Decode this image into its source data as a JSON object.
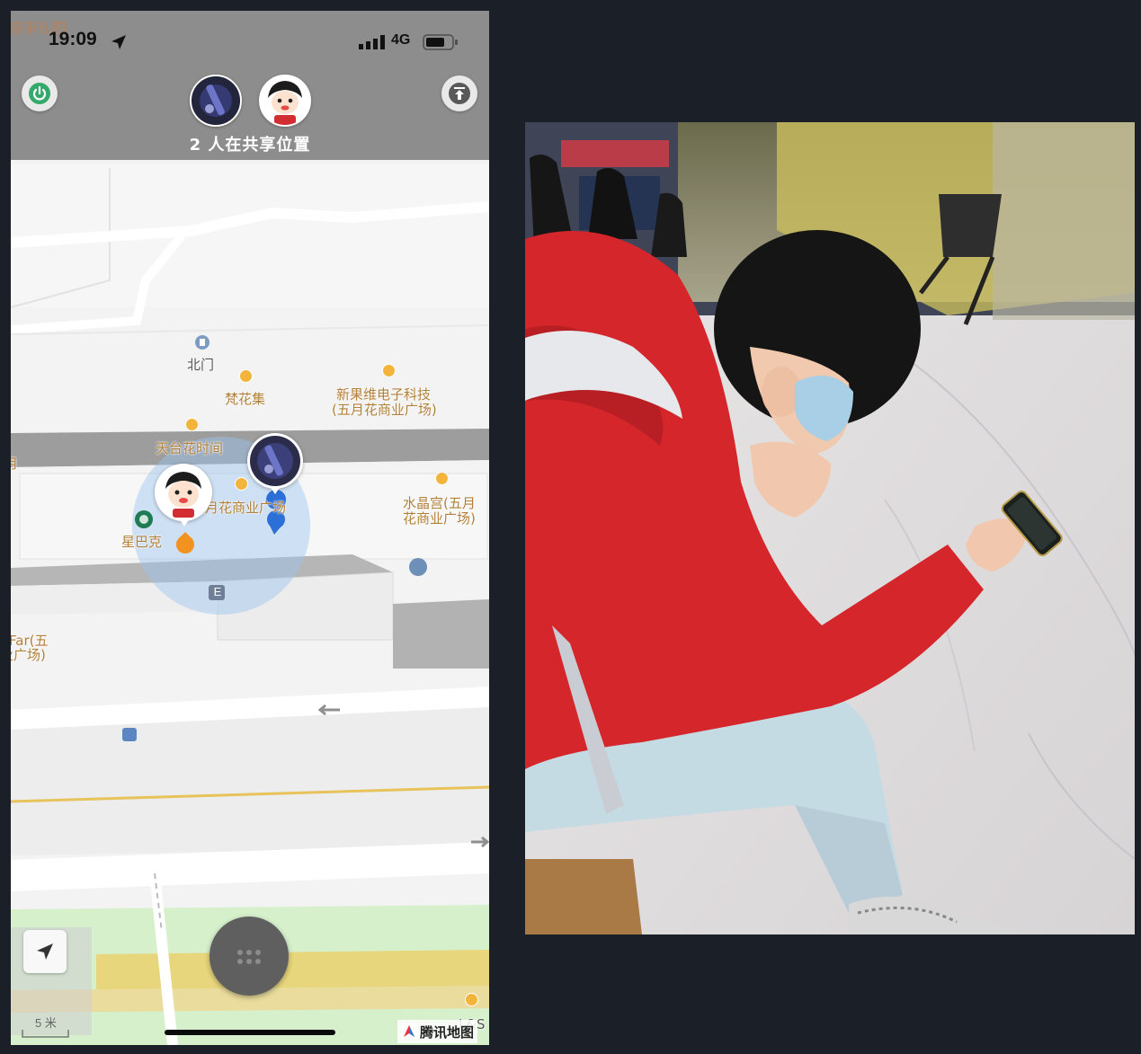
{
  "status_bar": {
    "time": "19:09",
    "network": "4G",
    "corner_text": "得来私厨"
  },
  "share": {
    "count_text": "2 人在共享位置",
    "avatars": [
      "avatar-dark-photo",
      "avatar-cartoon-boy"
    ]
  },
  "map": {
    "pois": {
      "north_gate": "北门",
      "fanhuaji": "梵花集",
      "xinguowei_1": "新果维电子科技",
      "xinguowei_2": "(五月花商业广场)",
      "tiantai": "天台花时间",
      "wuyuehua": "月花商业广场",
      "shuijinggong_1": "水晶宫(五月",
      "shuijinggong_2": "花商业广场)",
      "starbucks": "星巴克",
      "far_1": "Far(五",
      "far_2": "业广场)",
      "left_edge": "月",
      "bottom_right": "L&S Flow"
    },
    "entrance_letter": "E",
    "scale": "5 米",
    "brand": "腾讯地图"
  },
  "icons": [
    "power-icon",
    "upload-icon",
    "location-arrow-icon",
    "signal-icon",
    "battery-icon",
    "compass-icon",
    "menu-grid-icon"
  ],
  "colors": {
    "accent_green": "#35a86b",
    "poi_orange": "#f2b43a",
    "location_blue": "#2c6fd6",
    "hoodie_red": "#d5262b"
  }
}
